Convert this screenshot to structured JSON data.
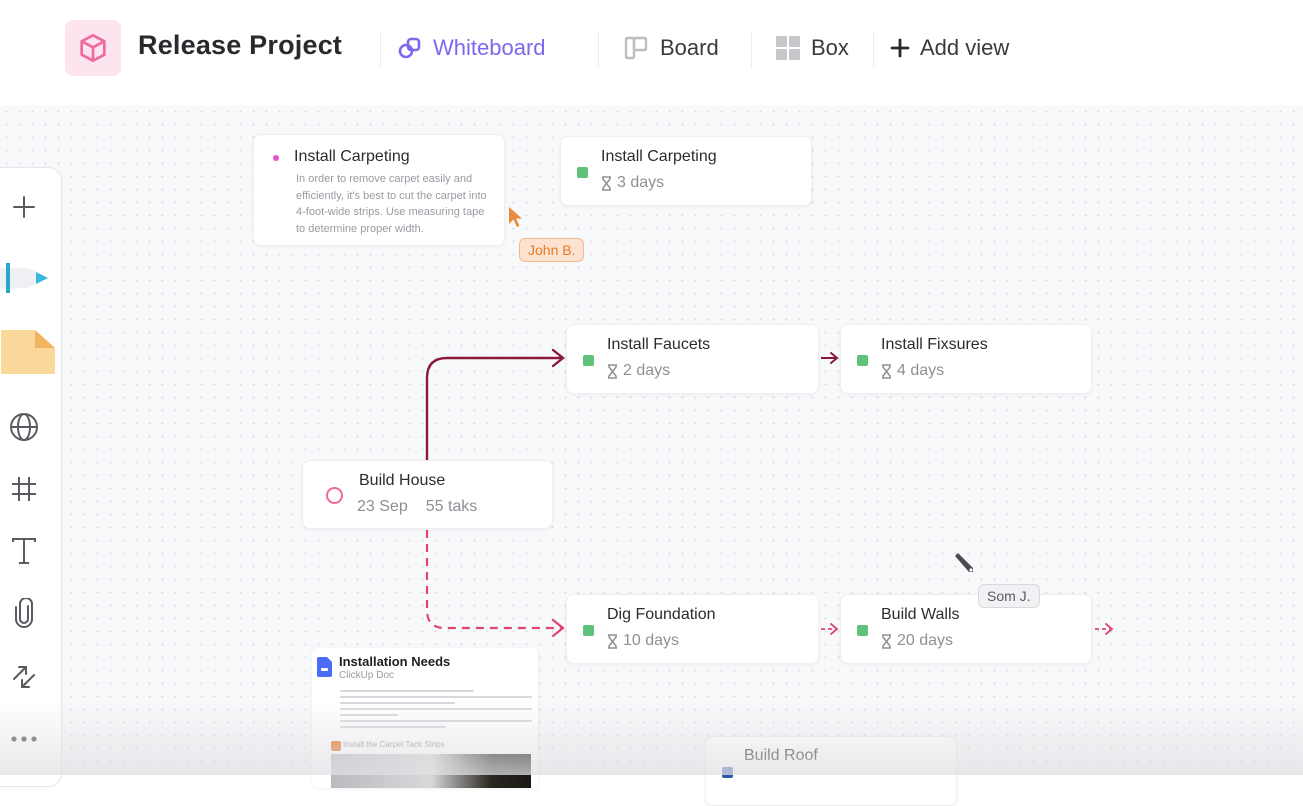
{
  "header": {
    "project_title": "Release Project",
    "project_icon": "cube-icon",
    "tabs": [
      {
        "label": "Whiteboard",
        "icon": "whiteboard-icon",
        "active": true
      },
      {
        "label": "Board",
        "icon": "board-icon",
        "active": false
      },
      {
        "label": "Box",
        "icon": "box-grid-icon",
        "active": false
      }
    ],
    "add_view_label": "Add view"
  },
  "colors": {
    "accent": "#7b68ee",
    "project_icon": "#f06a9b",
    "task_status": "#5fc27a",
    "solid_connector": "#8b1a3a",
    "dashed_connector": "#e0456e",
    "john_tag": "#e88a3c",
    "doc_icon": "#4a6cf7"
  },
  "toolbar": {
    "tools": [
      {
        "name": "add",
        "icon": "plus-icon"
      },
      {
        "name": "pen",
        "icon": "pen-icon"
      },
      {
        "name": "sticky-note",
        "icon": "sticky-note-icon"
      },
      {
        "name": "web-embed",
        "icon": "globe-icon"
      },
      {
        "name": "frame",
        "icon": "frame-icon"
      },
      {
        "name": "text",
        "icon": "text-icon"
      },
      {
        "name": "attachment",
        "icon": "paperclip-icon"
      },
      {
        "name": "connector",
        "icon": "connector-arrows-icon"
      },
      {
        "name": "more",
        "icon": "more-icon"
      }
    ]
  },
  "canvas": {
    "note": {
      "title": "Install Carpeting",
      "body": "In order to remove carpet easily and efficiently, it's best to cut the carpet into 4-foot-wide strips. Use measuring tape to determine proper width."
    },
    "tasks": [
      {
        "id": "install-carpeting",
        "title": "Install Carpeting",
        "duration": "3 days"
      },
      {
        "id": "install-faucets",
        "title": "Install Faucets",
        "duration": "2 days"
      },
      {
        "id": "install-fixsures",
        "title": "Install Fixsures",
        "duration": "4 days"
      },
      {
        "id": "dig-foundation",
        "title": "Dig Foundation",
        "duration": "10 days"
      },
      {
        "id": "build-walls",
        "title": "Build Walls",
        "duration": "20 days"
      },
      {
        "id": "build-roof",
        "title": "Build Roof",
        "duration": ""
      }
    ],
    "project_card": {
      "title": "Build House",
      "date": "23 Sep",
      "tasks_count": "55 taks"
    },
    "cursors": [
      {
        "name": "John B."
      },
      {
        "name": "Som J."
      }
    ],
    "doc": {
      "title": "Installation Needs",
      "subtitle": "ClickUp Doc",
      "section_heading": "Install the Carpet Tack Strips"
    }
  }
}
